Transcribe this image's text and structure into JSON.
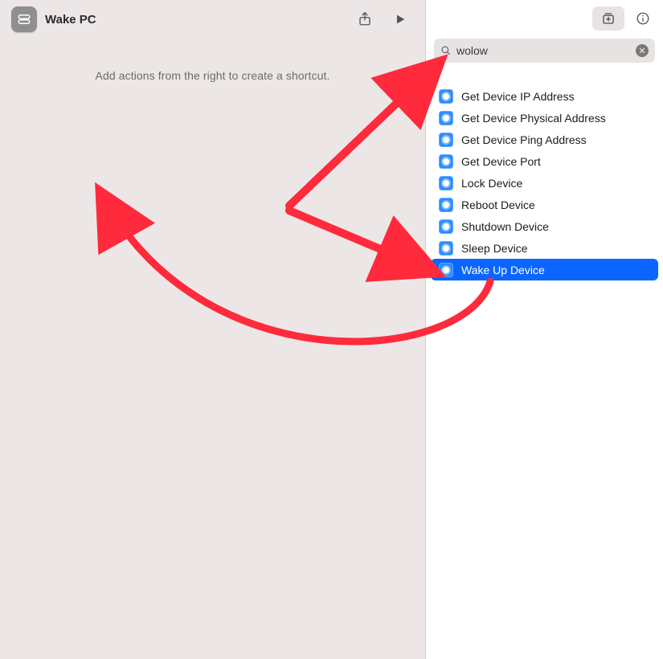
{
  "header": {
    "title": "Wake PC"
  },
  "editor": {
    "hint": "Add actions from the right to create a shortcut."
  },
  "search": {
    "value": "wolow"
  },
  "actions": [
    {
      "label": "Get Device IP Address",
      "selected": false
    },
    {
      "label": "Get Device Physical Address",
      "selected": false
    },
    {
      "label": "Get Device Ping Address",
      "selected": false
    },
    {
      "label": "Get Device Port",
      "selected": false
    },
    {
      "label": "Lock Device",
      "selected": false
    },
    {
      "label": "Reboot Device",
      "selected": false
    },
    {
      "label": "Shutdown Device",
      "selected": false
    },
    {
      "label": "Sleep Device",
      "selected": false
    },
    {
      "label": "Wake Up Device",
      "selected": true
    }
  ]
}
